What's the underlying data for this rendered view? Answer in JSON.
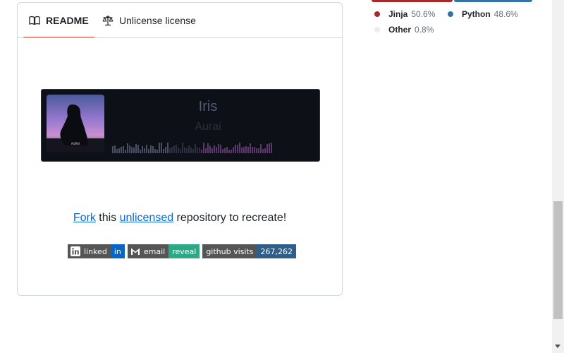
{
  "tabs": {
    "readme": "README",
    "license": "Unlicense license"
  },
  "player": {
    "title": "Iris",
    "artist": "Aurai",
    "cover_text": "AURAI"
  },
  "fork_line": {
    "link1": "Fork",
    "text1": " this ",
    "link2": "unlicensed",
    "text2": " repository to recreate!"
  },
  "badges": [
    {
      "left": "linked",
      "right": "in",
      "icon": "linkedin-icon"
    },
    {
      "left": "email",
      "right": "reveal",
      "icon": "gmail-icon"
    },
    {
      "left": "github visits",
      "right": "267,262"
    }
  ],
  "languages": [
    {
      "name": "Jinja",
      "pct": "50.6%",
      "color": "#a52a2a"
    },
    {
      "name": "Python",
      "pct": "48.6%",
      "color": "#3572a5"
    },
    {
      "name": "Other",
      "pct": "0.8%",
      "color": "#ededed"
    }
  ]
}
